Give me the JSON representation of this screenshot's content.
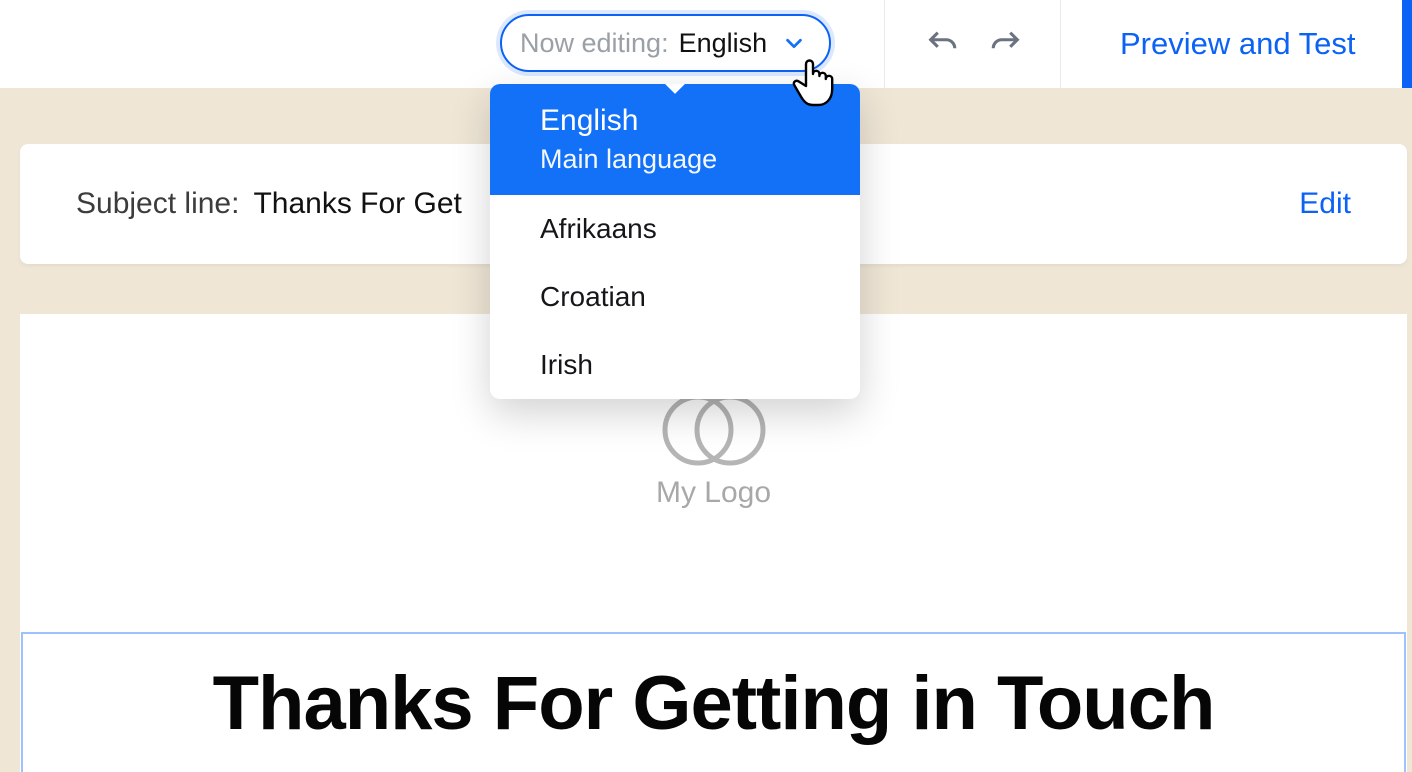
{
  "toolbar": {
    "now_editing_label": "Now editing:",
    "current_language": "English",
    "preview_label": "Preview and Test"
  },
  "languages": [
    {
      "name": "English",
      "sub": "Main language",
      "selected": true
    },
    {
      "name": "Afrikaans",
      "selected": false
    },
    {
      "name": "Croatian",
      "selected": false
    },
    {
      "name": "Irish",
      "selected": false
    }
  ],
  "subject": {
    "label": "Subject line:",
    "text": "Thanks For Get",
    "edit_label": "Edit"
  },
  "email": {
    "logo_text": "My Logo",
    "headline": "Thanks For Getting in Touch"
  }
}
